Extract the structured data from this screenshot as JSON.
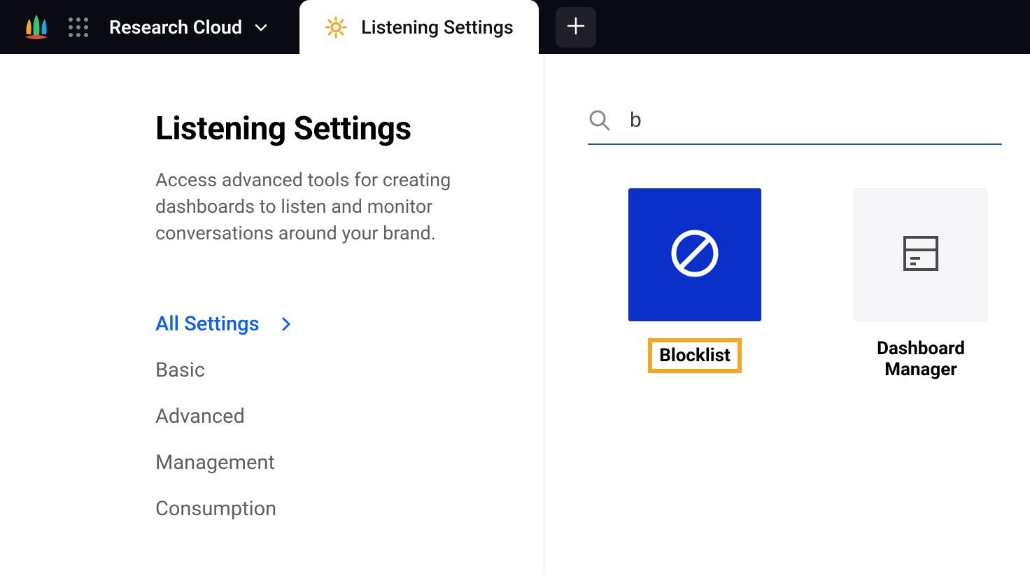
{
  "topbar": {
    "workspace_label": "Research Cloud",
    "active_tab_label": "Listening Settings"
  },
  "left_panel": {
    "title": "Listening Settings",
    "description": "Access advanced tools for creating dashboards to listen and monitor conversations around your brand.",
    "nav_items": [
      {
        "label": "All Settings",
        "active": true
      },
      {
        "label": "Basic",
        "active": false
      },
      {
        "label": "Advanced",
        "active": false
      },
      {
        "label": "Management",
        "active": false
      },
      {
        "label": "Consumption",
        "active": false
      }
    ]
  },
  "right_panel": {
    "search_value": "b",
    "tiles": [
      {
        "label": "Blocklist",
        "highlighted": true,
        "style": "blue",
        "icon": "block"
      },
      {
        "label": "Dashboard Manager",
        "highlighted": false,
        "style": "light",
        "icon": "dashboard"
      }
    ]
  }
}
